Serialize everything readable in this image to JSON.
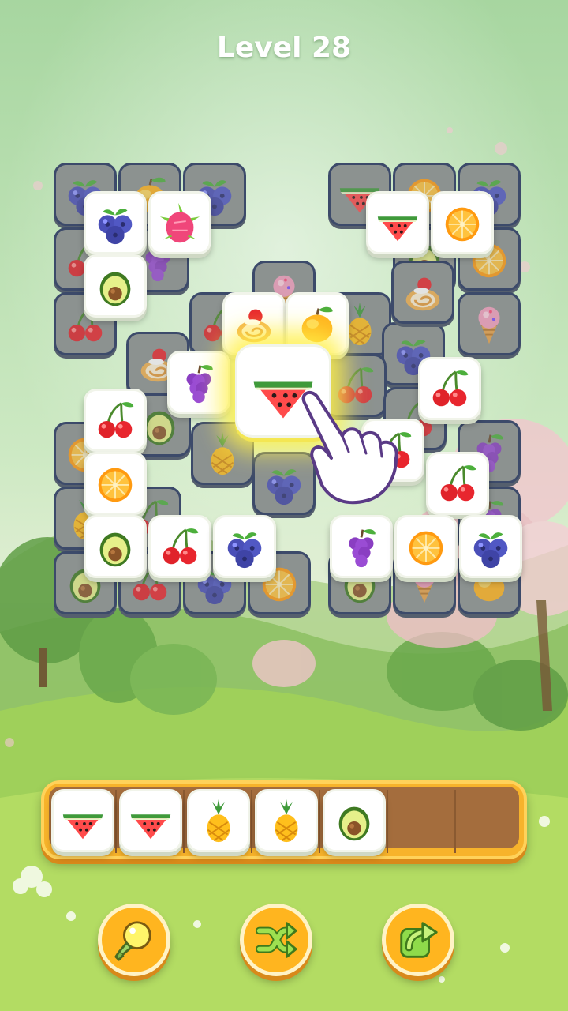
{
  "header": {
    "title": "Level 28"
  },
  "board": {
    "tiles": [
      {
        "fruit": "blueberry",
        "state": "covered"
      },
      {
        "fruit": "mango",
        "state": "covered"
      },
      {
        "fruit": "blueberry",
        "state": "covered"
      },
      {
        "fruit": "cherry",
        "state": "covered"
      },
      {
        "fruit": "cherry",
        "state": "covered"
      },
      {
        "fruit": "watermelon",
        "state": "covered"
      },
      {
        "fruit": "orange",
        "state": "covered"
      },
      {
        "fruit": "blueberry",
        "state": "covered"
      },
      {
        "fruit": "avocado",
        "state": "covered"
      },
      {
        "fruit": "orange",
        "state": "covered"
      },
      {
        "fruit": "ice-cream",
        "state": "covered"
      },
      {
        "fruit": "cake-roll",
        "state": "covered"
      },
      {
        "fruit": "cherry",
        "state": "covered"
      },
      {
        "fruit": "grape",
        "state": "covered"
      },
      {
        "fruit": "pineapple",
        "state": "covered"
      },
      {
        "fruit": "ice-cream",
        "state": "covered"
      },
      {
        "fruit": "blueberry",
        "state": "covered"
      },
      {
        "fruit": "cake-roll",
        "state": "covered"
      },
      {
        "fruit": "avocado",
        "state": "covered"
      },
      {
        "fruit": "cherry",
        "state": "covered"
      },
      {
        "fruit": "cherry",
        "state": "covered"
      },
      {
        "fruit": "orange",
        "state": "covered"
      },
      {
        "fruit": "pineapple",
        "state": "covered"
      },
      {
        "fruit": "blueberry",
        "state": "covered"
      },
      {
        "fruit": "grape",
        "state": "covered"
      },
      {
        "fruit": "pineapple",
        "state": "covered"
      },
      {
        "fruit": "cherry",
        "state": "covered"
      },
      {
        "fruit": "grape",
        "state": "covered"
      },
      {
        "fruit": "avocado",
        "state": "covered"
      },
      {
        "fruit": "cherry",
        "state": "covered"
      },
      {
        "fruit": "blueberry",
        "state": "covered"
      },
      {
        "fruit": "orange",
        "state": "covered"
      },
      {
        "fruit": "avocado",
        "state": "covered"
      },
      {
        "fruit": "ice-cream",
        "state": "covered"
      },
      {
        "fruit": "mango",
        "state": "covered"
      },
      {
        "fruit": "blueberry",
        "state": "open"
      },
      {
        "fruit": "dragon-fruit",
        "state": "open"
      },
      {
        "fruit": "avocado",
        "state": "open"
      },
      {
        "fruit": "watermelon",
        "state": "open"
      },
      {
        "fruit": "orange",
        "state": "open"
      },
      {
        "fruit": "cake-roll",
        "state": "open"
      },
      {
        "fruit": "mango",
        "state": "open"
      },
      {
        "fruit": "grape",
        "state": "open"
      },
      {
        "fruit": "cherry",
        "state": "open"
      },
      {
        "fruit": "cherry",
        "state": "open"
      },
      {
        "fruit": "cherry",
        "state": "open"
      },
      {
        "fruit": "orange",
        "state": "open"
      },
      {
        "fruit": "cherry",
        "state": "open"
      },
      {
        "fruit": "avocado",
        "state": "open"
      },
      {
        "fruit": "cherry",
        "state": "open"
      },
      {
        "fruit": "blueberry",
        "state": "open"
      },
      {
        "fruit": "grape",
        "state": "open"
      },
      {
        "fruit": "orange",
        "state": "open"
      },
      {
        "fruit": "blueberry",
        "state": "open"
      },
      {
        "fruit": "watermelon",
        "state": "highlighted"
      }
    ]
  },
  "tray": {
    "slots": [
      "watermelon",
      "watermelon",
      "pineapple",
      "pineapple",
      "avocado",
      "",
      ""
    ]
  },
  "controls": {
    "hint_icon": "lightbulb-icon",
    "shuffle_icon": "shuffle-icon",
    "undo_icon": "undo-arrow-icon"
  },
  "tutorial": {
    "pointer_icon": "pointing-hand-icon"
  }
}
